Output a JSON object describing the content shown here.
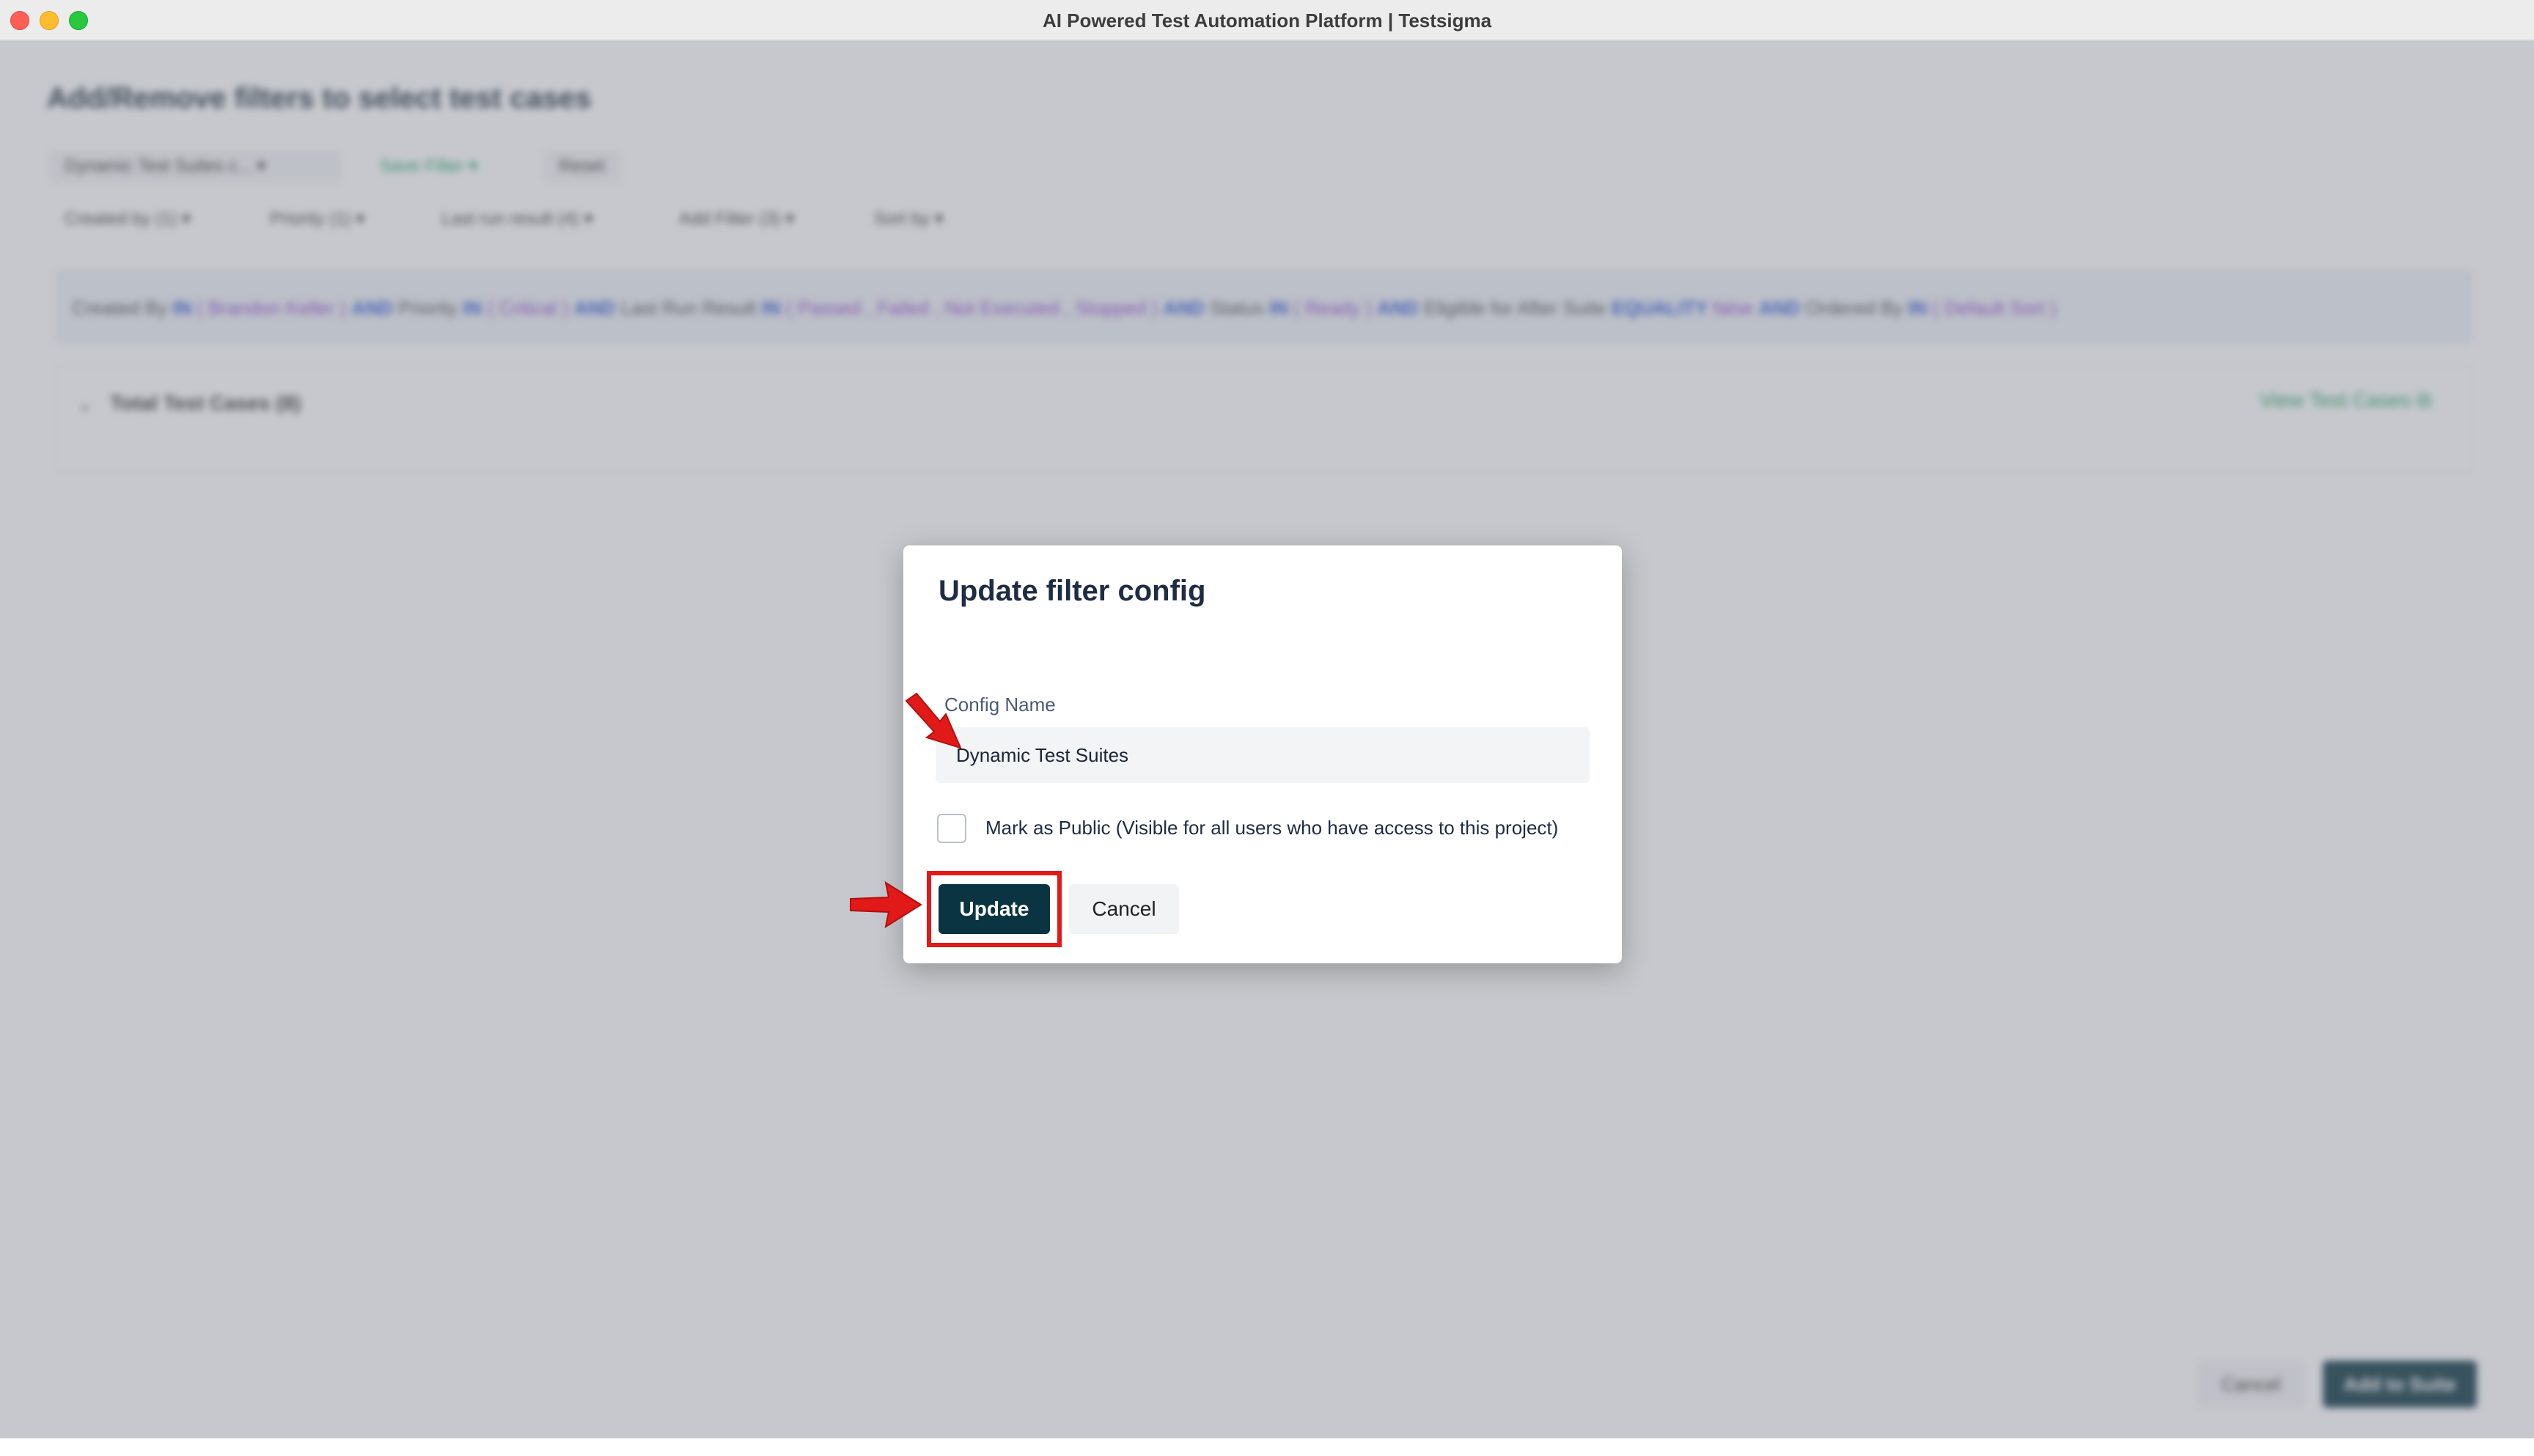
{
  "window": {
    "title": "AI Powered Test Automation Platform | Testsigma"
  },
  "background": {
    "page_title": "Add/Remove filters to select test cases",
    "toolbar": {
      "config_select": "Dynamic Test Suites c...",
      "save_filter": "Save Filter",
      "reset": "Reset"
    },
    "filters": [
      {
        "label": "Created by (1)"
      },
      {
        "label": "Priority (1)"
      },
      {
        "label": "Last run result (4)"
      },
      {
        "label": "Add Filter (3)"
      },
      {
        "label": "Sort by"
      }
    ],
    "query": {
      "created_by_label": "Created By",
      "created_by_op": "IN",
      "created_by_val": "( Brandon Keller )",
      "and": "AND",
      "priority_label": "Priority",
      "priority_op": "IN",
      "priority_val": "( Critical )",
      "result_label": "Last Run Result",
      "result_op": "IN",
      "result_val": "( Passed , Failed , Not Executed , Stopped )",
      "status_label": "Status",
      "status_op": "IN",
      "status_val": "( Ready )",
      "eligible_label": "Eligible for After Suite",
      "eligible_op": "EQUALITY",
      "eligible_val": "false",
      "ordered_label": "Ordered By",
      "ordered_op": "IN",
      "ordered_val": "( Default Sort )"
    },
    "total_cases": "Total Test Cases (8)",
    "view_test_cases": "View Test Cases",
    "bottom_cancel": "Cancel",
    "bottom_add": "Add to Suite"
  },
  "modal": {
    "title": "Update filter config",
    "config_name_label": "Config Name",
    "config_name_value": "Dynamic Test Suites",
    "public_label": "Mark as Public (Visible for all users who have access to this project)",
    "public_checked": false,
    "update_label": "Update",
    "cancel_label": "Cancel"
  },
  "colors": {
    "primary_button": "#0b3442",
    "annotation_red": "#e21919",
    "link_green": "#1b9e5a",
    "overlay": "#787c88"
  }
}
